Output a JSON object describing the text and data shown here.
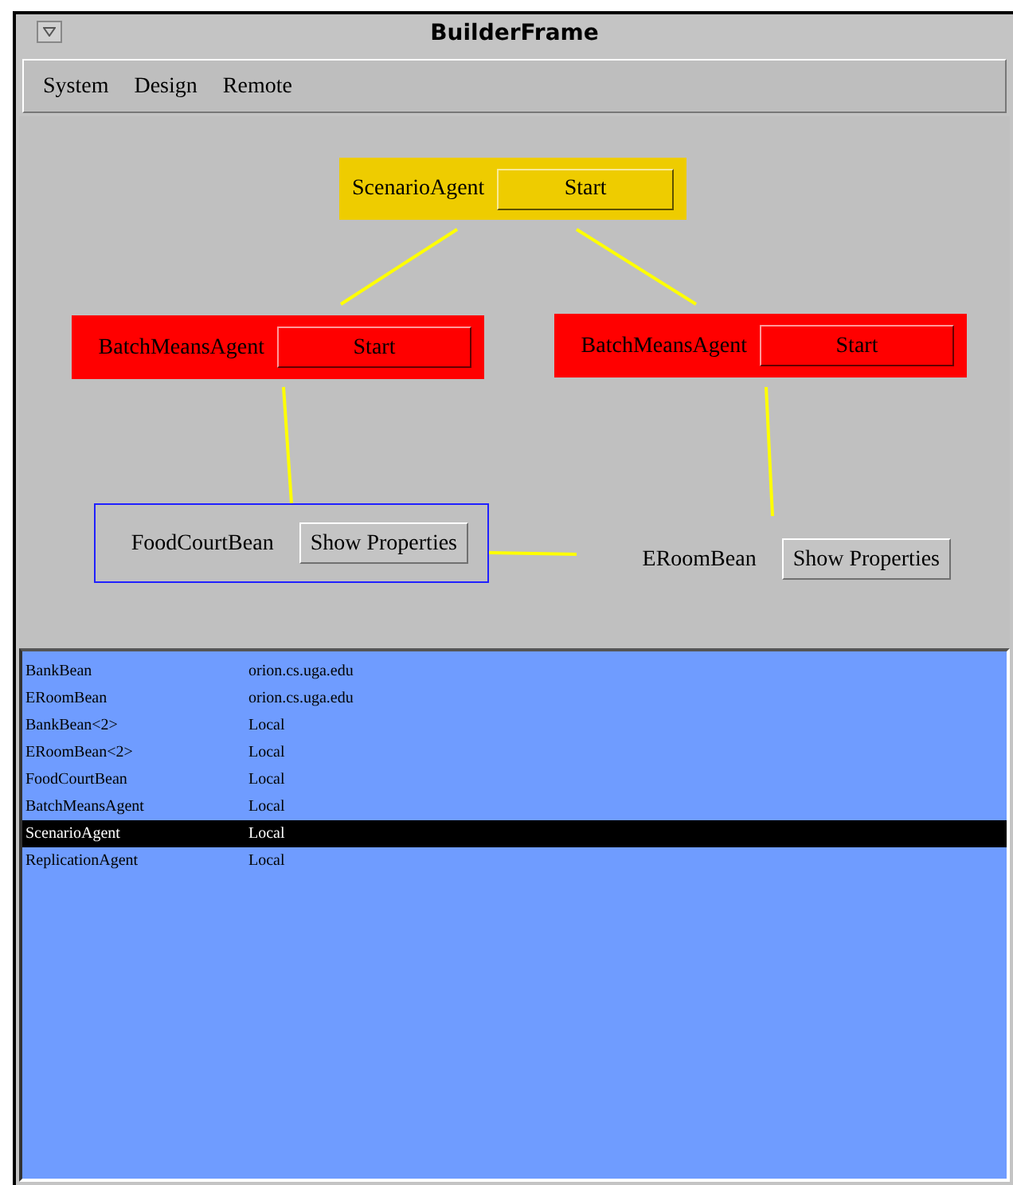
{
  "window": {
    "title": "BuilderFrame"
  },
  "menu": [
    "System",
    "Design",
    "Remote"
  ],
  "nodes": [
    {
      "kind": "agent",
      "name": "ScenarioAgent",
      "color": "#eecc00",
      "button": "Start"
    },
    {
      "kind": "agent",
      "name": "BatchMeansAgent",
      "color": "#ff0000",
      "button": "Start"
    },
    {
      "kind": "agent",
      "name": "BatchMeansAgent",
      "color": "#ff0000",
      "button": "Start"
    },
    {
      "kind": "bean",
      "name": "FoodCourtBean",
      "selected": true,
      "button": "Show Properties"
    },
    {
      "kind": "bean",
      "name": "ERoomBean",
      "selected": false,
      "button": "Show Properties"
    }
  ],
  "list": [
    {
      "name": "BankBean",
      "host": "orion.cs.uga.edu",
      "selected": false
    },
    {
      "name": "ERoomBean",
      "host": "orion.cs.uga.edu",
      "selected": false
    },
    {
      "name": "BankBean<2>",
      "host": "Local",
      "selected": false
    },
    {
      "name": "ERoomBean<2>",
      "host": "Local",
      "selected": false
    },
    {
      "name": "FoodCourtBean",
      "host": "Local",
      "selected": false
    },
    {
      "name": "BatchMeansAgent",
      "host": "Local",
      "selected": false
    },
    {
      "name": "ScenarioAgent",
      "host": "Local",
      "selected": true
    },
    {
      "name": "ReplicationAgent",
      "host": "Local",
      "selected": false
    }
  ]
}
